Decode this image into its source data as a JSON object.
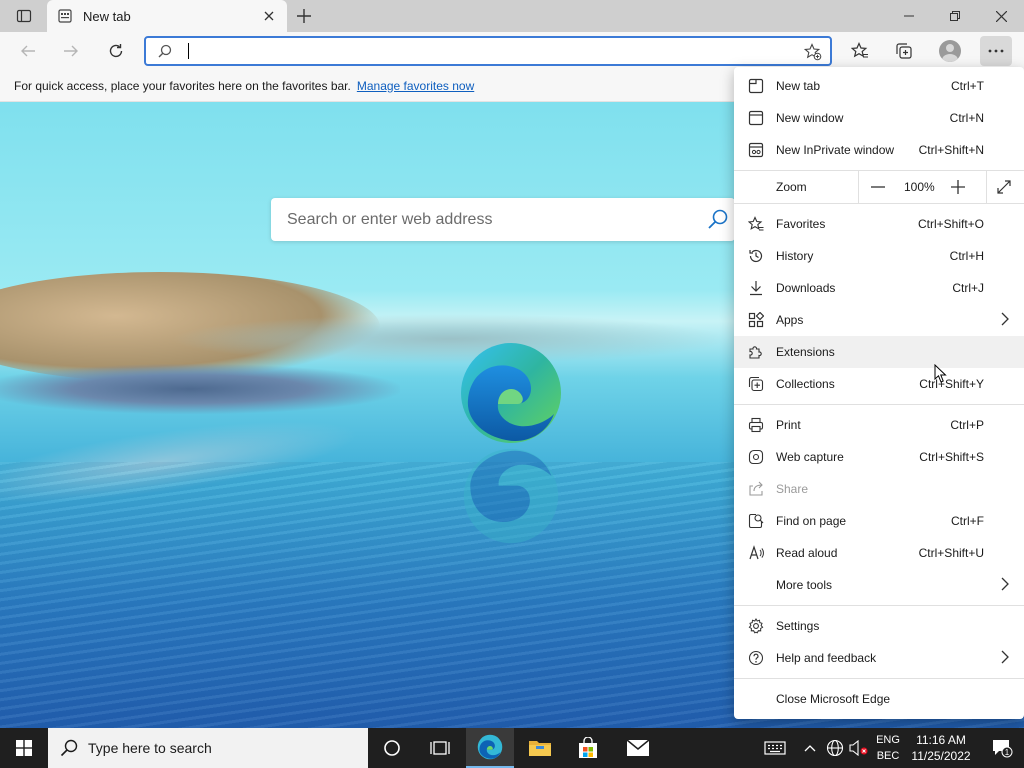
{
  "tab": {
    "title": "New tab"
  },
  "toolbar": {
    "address_value": ""
  },
  "favorites_bar": {
    "message": "For quick access, place your favorites here on the favorites bar.",
    "link": "Manage favorites now"
  },
  "page": {
    "search_placeholder": "Search or enter web address"
  },
  "menu": {
    "items": [
      {
        "label": "New tab",
        "shortcut": "Ctrl+T",
        "icon": "new-tab-icon"
      },
      {
        "label": "New window",
        "shortcut": "Ctrl+N",
        "icon": "window-icon"
      },
      {
        "label": "New InPrivate window",
        "shortcut": "Ctrl+Shift+N",
        "icon": "inprivate-icon"
      },
      {
        "label": "Favorites",
        "shortcut": "Ctrl+Shift+O",
        "icon": "favorites-icon"
      },
      {
        "label": "History",
        "shortcut": "Ctrl+H",
        "icon": "history-icon"
      },
      {
        "label": "Downloads",
        "shortcut": "Ctrl+J",
        "icon": "download-icon"
      },
      {
        "label": "Apps",
        "shortcut": "",
        "icon": "apps-icon"
      },
      {
        "label": "Extensions",
        "shortcut": "",
        "icon": "extensions-icon"
      },
      {
        "label": "Collections",
        "shortcut": "Ctrl+Shift+Y",
        "icon": "collections-icon"
      },
      {
        "label": "Print",
        "shortcut": "Ctrl+P",
        "icon": "print-icon"
      },
      {
        "label": "Web capture",
        "shortcut": "Ctrl+Shift+S",
        "icon": "web-capture-icon"
      },
      {
        "label": "Share",
        "shortcut": "",
        "icon": "share-icon"
      },
      {
        "label": "Find on page",
        "shortcut": "Ctrl+F",
        "icon": "find-icon"
      },
      {
        "label": "Read aloud",
        "shortcut": "Ctrl+Shift+U",
        "icon": "read-aloud-icon"
      },
      {
        "label": "More tools",
        "shortcut": "",
        "icon": ""
      },
      {
        "label": "Settings",
        "shortcut": "",
        "icon": "settings-icon"
      },
      {
        "label": "Help and feedback",
        "shortcut": "",
        "icon": "help-icon"
      },
      {
        "label": "Close Microsoft Edge",
        "shortcut": "",
        "icon": ""
      }
    ],
    "zoom": {
      "label": "Zoom",
      "value": "100%"
    }
  },
  "taskbar": {
    "search_placeholder": "Type here to search",
    "language_top": "ENG",
    "language_bottom": "BEC",
    "time": "11:16 AM",
    "date": "11/25/2022",
    "notification_count": "1"
  },
  "colors": {
    "accent": "#3c7ad6",
    "link": "#0f5fbf",
    "taskbar": "#1f1f1f"
  }
}
